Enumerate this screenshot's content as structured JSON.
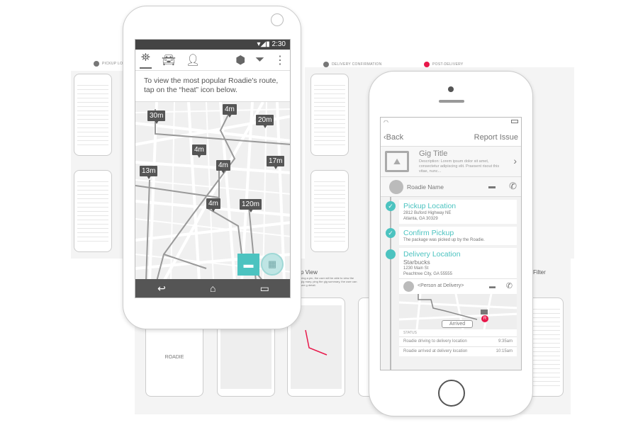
{
  "board": {
    "sections": [
      {
        "label": "PICKUP LOC"
      },
      {
        "label": "DELIVERY CONFIRMATION"
      },
      {
        "label": "POST-DELIVERY"
      }
    ],
    "notes": [
      {
        "title": "p View",
        "text": "ping a pin, the user will be able to view the gig mary. ping the gig summary, the user can see g detail."
      },
      {
        "title": "Filter"
      }
    ],
    "thumb_brand": "ROADIE"
  },
  "android": {
    "time": "2:30",
    "tabs": [
      {
        "icon": "map-pin-icon"
      },
      {
        "icon": "car-icon"
      },
      {
        "icon": "person-icon"
      }
    ],
    "actions": [
      {
        "icon": "add-package-icon"
      },
      {
        "icon": "filter-icon"
      },
      {
        "icon": "more-vert-icon"
      }
    ],
    "info": "To view the most popular Roadie's route, tap on the “heat” icon below.",
    "pins": [
      "30m",
      "4m",
      "20m",
      "4m",
      "4m",
      "13m",
      "17m",
      "4m",
      "120m"
    ],
    "nav": [
      {
        "icon": "back-icon"
      },
      {
        "icon": "home-icon"
      },
      {
        "icon": "recents-icon"
      }
    ]
  },
  "iphone": {
    "back": "Back",
    "report": "Report Issue",
    "gig_title": "Gig Title",
    "gig_desc": "Description: Lorem ipsum dolor sit amet, consectetur adipiscing elit. Praesent risout this vitae, nunc...",
    "roadie_name": "Roadie Name",
    "steps": [
      {
        "title": "Pickup Location",
        "lines": [
          "2812 Buford Highway NE",
          "Atlanta, GA 30329"
        ]
      },
      {
        "title": "Confirm Pickup",
        "lines": [
          "The package was picked up by the Roadie."
        ]
      },
      {
        "title": "Delivery Location",
        "place": "Starbucks",
        "lines": [
          "1230 Main St",
          "Peachtree City, GA 55555"
        ]
      }
    ],
    "person": "<Person at Delivery>",
    "arrived": "Arrived",
    "status_label": "STATUS",
    "status": [
      {
        "text": "Roadie driving to delivery location",
        "time": "9:35am"
      },
      {
        "text": "Roadie arrived at delivery location",
        "time": "10:15am"
      }
    ]
  },
  "colors": {
    "accent": "#4cc3c0",
    "alert": "#e8174a"
  }
}
